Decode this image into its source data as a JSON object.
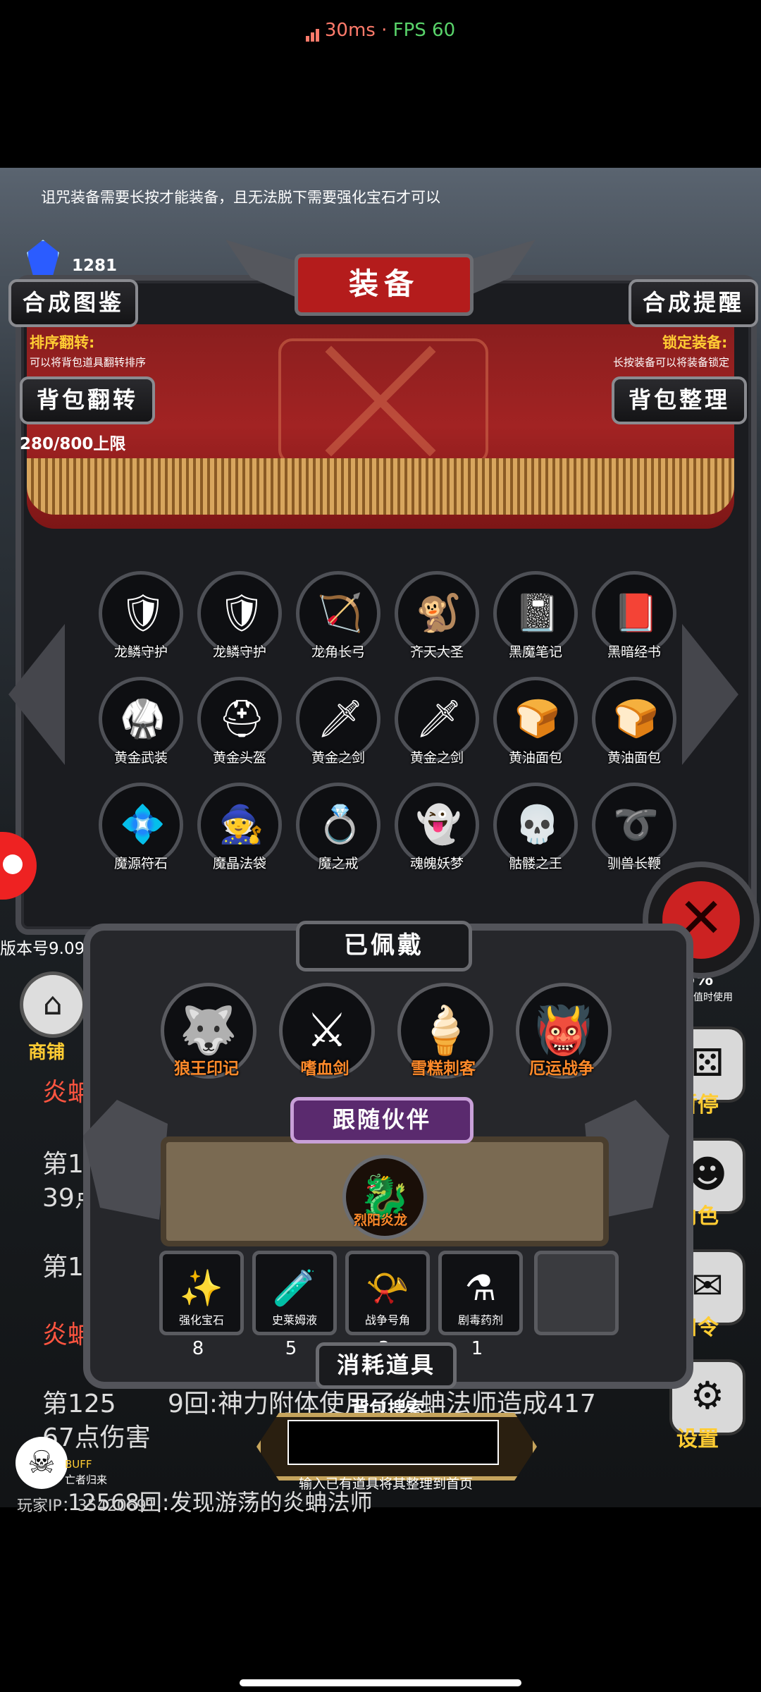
{
  "status": {
    "ping": "30ms",
    "sep": "·",
    "fps": "FPS 60"
  },
  "top": {
    "tip": "诅咒装备需要长按才能装备，且无法脱下需要强化宝石才可以",
    "gem_count": "1281"
  },
  "panel": {
    "title": "装备",
    "left_top_btn": "合成图鉴",
    "right_top_btn": "合成提醒",
    "sort_label": "排序翻转:",
    "sort_desc": "可以将背包道具翻转排序",
    "lock_label": "锁定装备:",
    "lock_desc": "长按装备可以将装备锁定",
    "flip_btn": "背包翻转",
    "tidy_btn": "背包整理",
    "capacity": "280/800上限"
  },
  "items": [
    {
      "name": "龙鳞守护",
      "icon": "🛡"
    },
    {
      "name": "龙鳞守护",
      "icon": "🛡"
    },
    {
      "name": "龙角长弓",
      "icon": "🏹"
    },
    {
      "name": "齐天大圣",
      "icon": "🐒"
    },
    {
      "name": "黑魔笔记",
      "icon": "📓"
    },
    {
      "name": "黑暗经书",
      "icon": "📕"
    },
    {
      "name": "黄金武装",
      "icon": "🥋"
    },
    {
      "name": "黄金头盔",
      "icon": "⛑"
    },
    {
      "name": "黄金之剑",
      "icon": "🗡"
    },
    {
      "name": "黄金之剑",
      "icon": "🗡"
    },
    {
      "name": "黄油面包",
      "icon": "🍞"
    },
    {
      "name": "黄油面包",
      "icon": "🍞"
    },
    {
      "name": "魔源符石",
      "icon": "💠"
    },
    {
      "name": "魔晶法袋",
      "icon": "🧙"
    },
    {
      "name": "魔之戒",
      "icon": "💍"
    },
    {
      "name": "魂魄妖梦",
      "icon": "👻"
    },
    {
      "name": "骷髅之王",
      "icon": "💀"
    },
    {
      "name": "驯兽长鞭",
      "icon": "➰"
    }
  ],
  "equipped": {
    "title": "已佩戴",
    "slots": [
      {
        "name": "狼王印记",
        "icon": "🐺"
      },
      {
        "name": "嗜血剑",
        "icon": "⚔"
      },
      {
        "name": "雪糕刺客",
        "icon": "🍦"
      },
      {
        "name": "厄运战争",
        "icon": "👹"
      }
    ]
  },
  "companion": {
    "title": "跟随伙伴",
    "name": "烈阳炎龙",
    "icon": "🐉"
  },
  "consumables": {
    "title": "消耗道具",
    "slots": [
      {
        "name": "强化宝石",
        "count": "8",
        "icon": "✨"
      },
      {
        "name": "史莱姆液",
        "count": "5",
        "icon": "🧪"
      },
      {
        "name": "战争号角",
        "count": "3",
        "icon": "📯"
      },
      {
        "name": "剧毒药剂",
        "count": "1",
        "icon": "⚗"
      }
    ]
  },
  "search": {
    "label": "背包搜索",
    "hint": "输入已有道具将其整理到首页",
    "value": ""
  },
  "left": {
    "version": "版本号9.09",
    "shop": "商铺",
    "log1": "炎蚺",
    "log2": "第12",
    "log3": "39点",
    "log4": "第12",
    "log5": "炎蚺",
    "log6": "第125",
    "log6b": "9回:神力附体使用了炎蚺法师造成417",
    "log7": "67点伤害",
    "log8": "12568回:发现游荡的炎蚺法师"
  },
  "buff": {
    "label": "BUFF",
    "desc": "亡者归来"
  },
  "player_ip": "玩家IP：35420691",
  "right": {
    "pct": "76%",
    "pct_sub": "其数值时使用",
    "pause": "暂停",
    "role": "角色",
    "code": "口令",
    "settings": "设置"
  },
  "colors": {
    "accent_red": "#b41c1c",
    "gold": "#ffcc33",
    "orange_label": "#ff8a2a"
  }
}
